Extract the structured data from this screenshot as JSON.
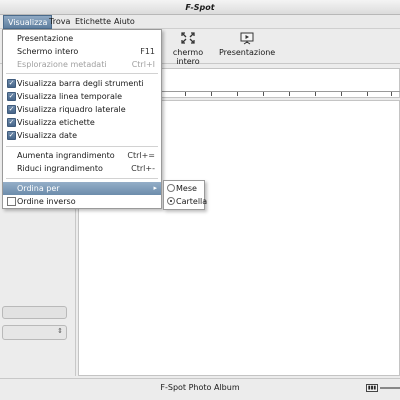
{
  "window": {
    "title": "F-Spot"
  },
  "menubar": {
    "items": [
      {
        "label": "Visualizza"
      },
      {
        "label": "Trova"
      },
      {
        "label": "Etichette"
      },
      {
        "label": "Aiuto"
      }
    ]
  },
  "toolbar": {
    "fullscreen_label": "chermo intero",
    "slideshow_label": "Presentazione"
  },
  "view_menu": {
    "items": [
      {
        "label": "Presentazione",
        "accel": ""
      },
      {
        "label": "Schermo intero",
        "accel": "F11"
      },
      {
        "label": "Esplorazione metadati",
        "accel": "Ctrl+I"
      },
      {
        "label": "Visualizza barra degli strumenti",
        "accel": "",
        "checked": true
      },
      {
        "label": "Visualizza linea temporale",
        "accel": "",
        "checked": true
      },
      {
        "label": "Visualizza riquadro laterale",
        "accel": "",
        "checked": true
      },
      {
        "label": "Visualizza etichette",
        "accel": "",
        "checked": true
      },
      {
        "label": "Visualizza date",
        "accel": "",
        "checked": true
      },
      {
        "label": "Aumenta ingrandimento",
        "accel": "Ctrl+="
      },
      {
        "label": "Riduci ingrandimento",
        "accel": "Ctrl+-"
      },
      {
        "label": "Ordina per",
        "accel": ""
      },
      {
        "label": "Ordine inverso",
        "accel": "",
        "checked": false
      }
    ]
  },
  "sort_submenu": {
    "items": [
      {
        "label": "Mese",
        "selected": false
      },
      {
        "label": "Cartella",
        "selected": true
      }
    ]
  },
  "statusbar": {
    "text": "F-Spot Photo Album"
  },
  "colors": {
    "accent": "#6c8cab",
    "check": "#48668a"
  }
}
